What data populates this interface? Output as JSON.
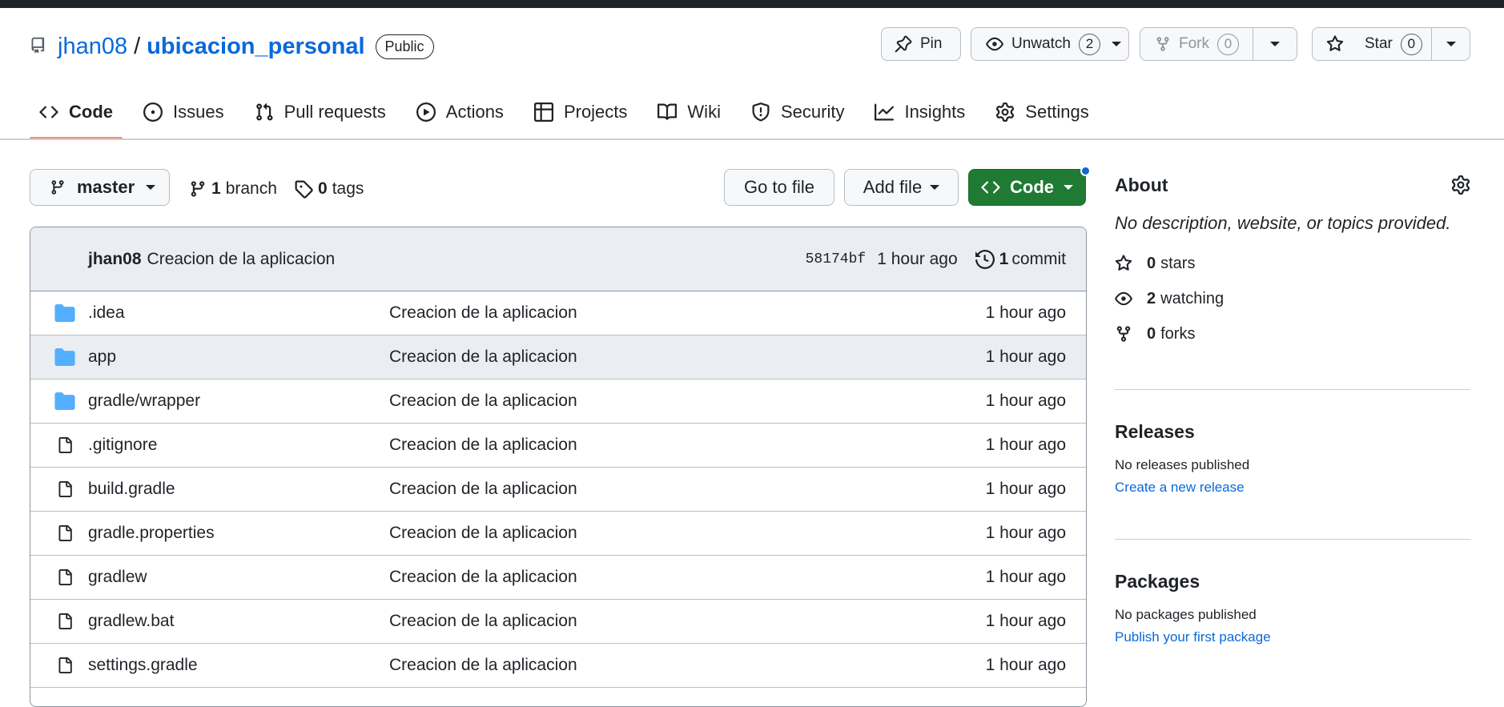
{
  "repo": {
    "owner": "jhan08",
    "separator": "/",
    "name": "ubicacion_personal",
    "visibility": "Public"
  },
  "header_buttons": {
    "pin": "Pin",
    "unwatch": "Unwatch",
    "watch_count": "2",
    "fork": "Fork",
    "fork_count": "0",
    "star": "Star",
    "star_count": "0"
  },
  "nav": [
    {
      "label": "Code",
      "icon": "code-icon",
      "active": true
    },
    {
      "label": "Issues",
      "icon": "issue-icon"
    },
    {
      "label": "Pull requests",
      "icon": "pull-request-icon"
    },
    {
      "label": "Actions",
      "icon": "play-icon"
    },
    {
      "label": "Projects",
      "icon": "table-icon"
    },
    {
      "label": "Wiki",
      "icon": "book-icon"
    },
    {
      "label": "Security",
      "icon": "shield-icon"
    },
    {
      "label": "Insights",
      "icon": "graph-icon"
    },
    {
      "label": "Settings",
      "icon": "gear-icon"
    }
  ],
  "toolbar": {
    "branch": "master",
    "branch_count": "1",
    "branch_word": "branch",
    "tag_count": "0",
    "tag_word": "tags",
    "go_to_file": "Go to file",
    "add_file": "Add file",
    "code": "Code"
  },
  "latest_commit": {
    "author": "jhan08",
    "message": "Creacion de la aplicacion",
    "sha": "58174bf",
    "age": "1 hour ago",
    "commit_count": "1",
    "commit_word": "commit"
  },
  "files": [
    {
      "name": ".idea",
      "type": "folder",
      "message": "Creacion de la aplicacion",
      "age": "1 hour ago"
    },
    {
      "name": "app",
      "type": "folder",
      "message": "Creacion de la aplicacion",
      "age": "1 hour ago"
    },
    {
      "name": "gradle/wrapper",
      "type": "folder",
      "message": "Creacion de la aplicacion",
      "age": "1 hour ago"
    },
    {
      "name": ".gitignore",
      "type": "file",
      "message": "Creacion de la aplicacion",
      "age": "1 hour ago"
    },
    {
      "name": "build.gradle",
      "type": "file",
      "message": "Creacion de la aplicacion",
      "age": "1 hour ago"
    },
    {
      "name": "gradle.properties",
      "type": "file",
      "message": "Creacion de la aplicacion",
      "age": "1 hour ago"
    },
    {
      "name": "gradlew",
      "type": "file",
      "message": "Creacion de la aplicacion",
      "age": "1 hour ago"
    },
    {
      "name": "gradlew.bat",
      "type": "file",
      "message": "Creacion de la aplicacion",
      "age": "1 hour ago"
    },
    {
      "name": "settings.gradle",
      "type": "file",
      "message": "Creacion de la aplicacion",
      "age": "1 hour ago"
    }
  ],
  "about": {
    "title": "About",
    "description": "No description, website, or topics provided.",
    "stars_count": "0",
    "stars_word": "stars",
    "watching_count": "2",
    "watching_word": "watching",
    "forks_count": "0",
    "forks_word": "forks"
  },
  "releases": {
    "title": "Releases",
    "text": "No releases published",
    "link": "Create a new release"
  },
  "packages": {
    "title": "Packages",
    "text": "No packages published",
    "link": "Publish your first package"
  },
  "colors": {
    "accent_blue": "#0969da",
    "code_button_green": "#1f7a33",
    "folder_blue": "#54aeff",
    "active_tab_underline": "#fd8c73"
  }
}
